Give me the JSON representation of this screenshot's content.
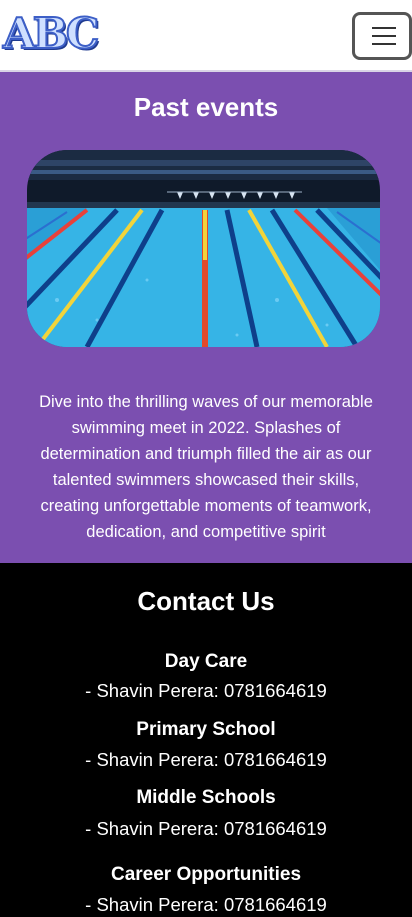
{
  "header": {
    "logo_text": "ABC",
    "menu_icon": "hamburger-menu-icon"
  },
  "events": {
    "title": "Past events",
    "image_alt": "swimming-pool-lanes",
    "description": "Dive into the thrilling waves of our memorable swimming meet in 2022. Splashes of determination and triumph filled the air as our talented swimmers showcased their skills, creating unforgettable moments of teamwork, dedication, and competitive spirit"
  },
  "contact": {
    "title": "Contact Us",
    "sections": [
      {
        "heading": "Day Care",
        "line": "- Shavin Perera: 0781664619"
      },
      {
        "heading": "Primary School",
        "line": "- Shavin Perera: 0781664619"
      },
      {
        "heading": "Middle Schools",
        "line": "- Shavin Perera: 0781664619"
      },
      {
        "heading": "Career Opportunities",
        "line": "- Shavin Perera: 0781664619"
      }
    ]
  },
  "colors": {
    "events_bg": "#7b4fb0",
    "contact_bg": "#000000",
    "logo_blue": "#3d5fc7"
  }
}
